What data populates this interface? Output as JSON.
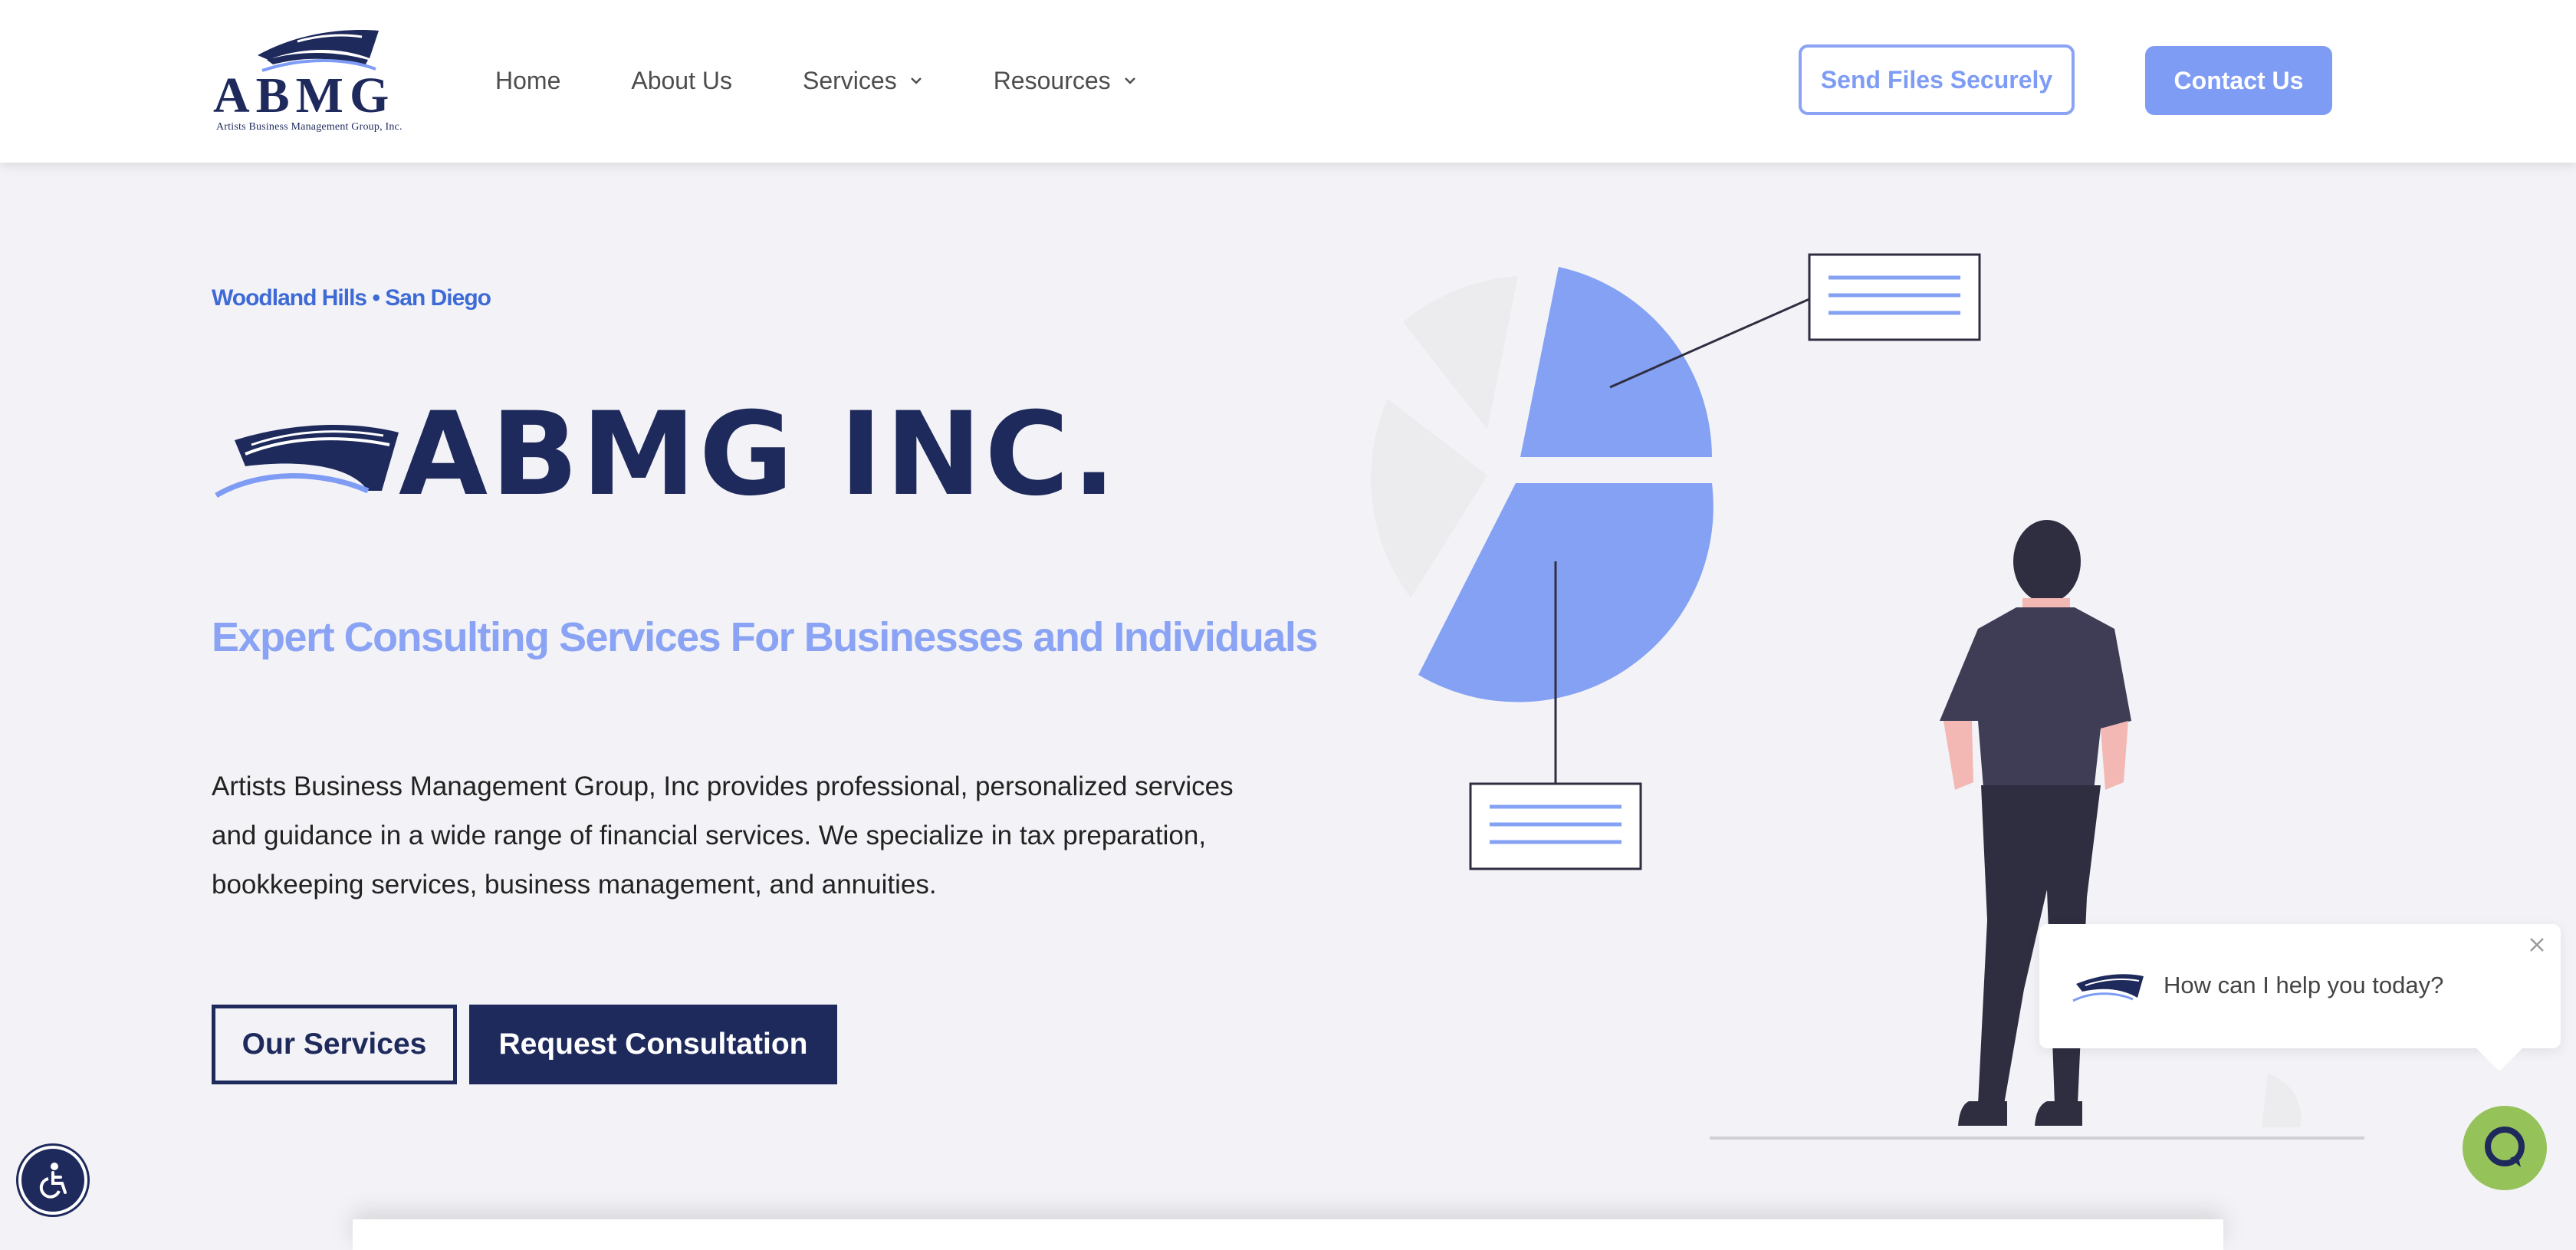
{
  "header": {
    "logo": {
      "letters": "ABMG",
      "tagline": "Artists Business Management Group, Inc."
    },
    "nav": [
      {
        "label": "Home",
        "has_dropdown": false
      },
      {
        "label": "About Us",
        "has_dropdown": false
      },
      {
        "label": "Services",
        "has_dropdown": true
      },
      {
        "label": "Resources",
        "has_dropdown": true
      }
    ],
    "send_files_label": "Send Files Securely",
    "contact_label": "Contact Us"
  },
  "hero": {
    "locations": "Woodland Hills • San Diego",
    "brand_wordmark": "ABMG INC.",
    "tagline": "Expert Consulting Services For Businesses and Individuals",
    "description": "Artists Business Management Group, Inc provides professional, personalized services and guidance in a wide range of financial services. We specialize in tax preparation, bookkeeping services, business management, and annuities.",
    "primary_button": "Our Services",
    "secondary_button": "Request Consultation"
  },
  "chat": {
    "prompt": "How can I help you today?"
  },
  "icons": {
    "accessibility": "accessibility-icon",
    "chat": "chat-icon",
    "close": "close-icon",
    "chevron": "chevron-down-icon"
  },
  "colors": {
    "navy": "#1f2a5c",
    "accent": "#7f9cf5",
    "link_blue": "#3d6ad6",
    "chat_green": "#96c25a",
    "background": "#f3f3f7"
  }
}
